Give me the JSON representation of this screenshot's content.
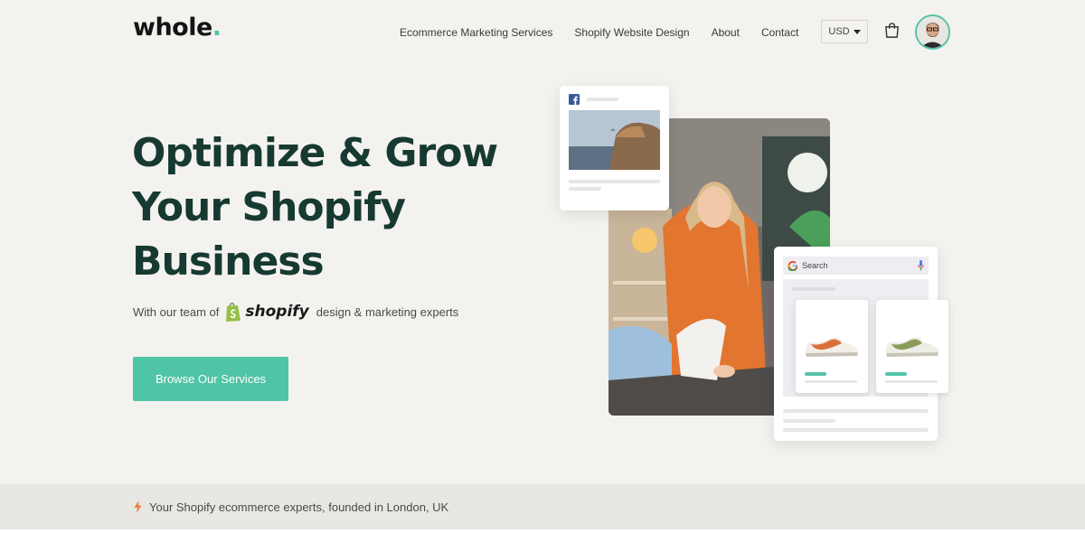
{
  "header": {
    "logo_text": "whole",
    "logo_dot": ".",
    "nav": [
      {
        "label": "Ecommerce Marketing Services"
      },
      {
        "label": "Shopify Website Design"
      },
      {
        "label": "About"
      },
      {
        "label": "Contact"
      }
    ],
    "currency": "USD",
    "cart_icon": "shopping-bag-icon",
    "avatar_icon": "user-avatar"
  },
  "hero": {
    "title": "Optimize & Grow Your Shopify Business",
    "subline_prefix": "With our team of",
    "shopify_word": "shopify",
    "subline_suffix": "design & marketing experts",
    "cta_label": "Browse Our Services"
  },
  "illustration": {
    "search_label": "Search",
    "fb_icon": "facebook-icon",
    "google_icon": "google-icon",
    "mic_icon": "microphone-icon"
  },
  "strip": {
    "text": "Your Shopify ecommerce experts, founded in London, UK",
    "icon": "lightning-bolt-icon"
  },
  "colors": {
    "accent": "#50c4a6",
    "heading": "#163a32",
    "background": "#f4f2ef"
  }
}
